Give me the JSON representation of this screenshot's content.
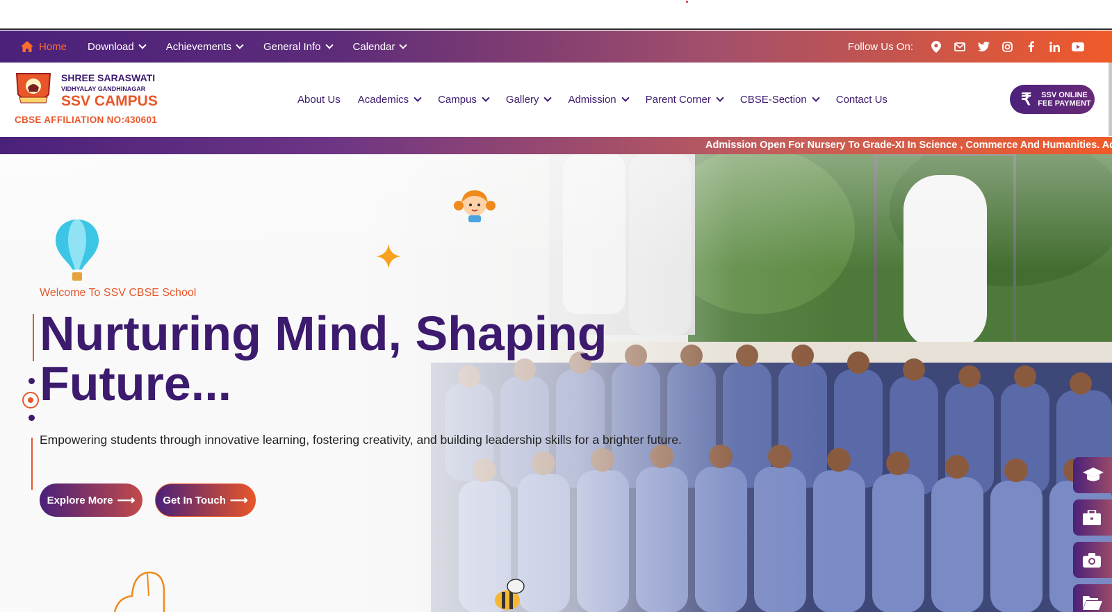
{
  "colors": {
    "brand_purple": "#3c1a6e",
    "brand_orange": "#e8562a",
    "white": "#ffffff"
  },
  "topbar": {
    "nav": [
      {
        "label": "Home",
        "icon": "home-icon",
        "active": true
      },
      {
        "label": "Download",
        "has_dropdown": true
      },
      {
        "label": "Achievements",
        "has_dropdown": true
      },
      {
        "label": "General Info",
        "has_dropdown": true
      },
      {
        "label": "Calendar",
        "has_dropdown": true
      }
    ],
    "follow_label": "Follow Us On:",
    "social_icons": [
      "location-pin-icon",
      "mail-icon",
      "twitter-icon",
      "instagram-icon",
      "facebook-icon",
      "linkedin-icon",
      "youtube-icon"
    ]
  },
  "header": {
    "school_name_line1": "SHREE SARASWATI",
    "school_name_line2": "VIDHYALAY GANDHINAGAR",
    "school_name_line3": "SSV CAMPUS",
    "affiliation": "CBSE AFFILIATION NO:430601",
    "logo_icon": "school-crest-logo",
    "nav": [
      {
        "label": "About Us",
        "has_dropdown": false
      },
      {
        "label": "Academics",
        "has_dropdown": true
      },
      {
        "label": "Campus",
        "has_dropdown": true
      },
      {
        "label": "Gallery",
        "has_dropdown": true
      },
      {
        "label": "Admission",
        "has_dropdown": true
      },
      {
        "label": "Parent Corner",
        "has_dropdown": true
      },
      {
        "label": "CBSE-Section",
        "has_dropdown": true
      },
      {
        "label": "Contact Us",
        "has_dropdown": false
      }
    ],
    "fee_button": {
      "icon": "rupee-icon",
      "line1": "SSV ONLINE",
      "line2": "FEE PAYMENT"
    }
  },
  "ticker": {
    "text": "Admission Open For Nursery To Grade-XI In Science , Commerce And Humanities. Admis"
  },
  "hero": {
    "welcome": "Welcome To SSV CBSE School",
    "headline_line1": "Nurturing Mind, Shaping",
    "headline_line2": "Future...",
    "subtext": "Empowering students through innovative learning, fostering creativity, and building leadership skills for a brighter future.",
    "explore_button": "Explore More",
    "touch_button": "Get In Touch",
    "decorations": [
      "hot-air-balloon-icon",
      "cartoon-girl-icon",
      "star-icon",
      "bee-icon"
    ]
  },
  "side_tabs": [
    {
      "icon": "graduation-cap-icon"
    },
    {
      "icon": "briefcase-icon"
    },
    {
      "icon": "camera-icon"
    },
    {
      "icon": "folder-open-icon"
    }
  ]
}
